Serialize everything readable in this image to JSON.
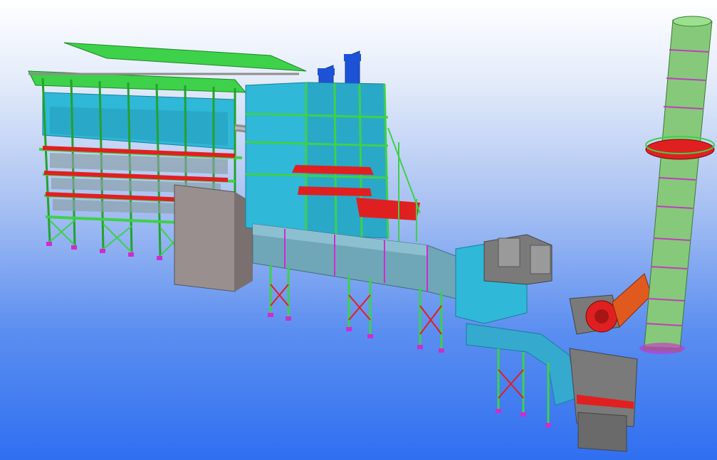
{
  "scene": {
    "kind": "3d-plant-model-view",
    "components": [
      "boiler-steel-structure",
      "heat-recovery-module",
      "flue-gas-duct",
      "scr-reactor",
      "induced-draft-fan",
      "chimney-stack"
    ]
  },
  "colors": {
    "background_top": "#ffffff",
    "background_bottom": "#2f6ff0",
    "steel": "#3ed14a",
    "steel_dark": "#22a32c",
    "panel": "#2fb8d8",
    "panel_dark": "#1d8fb0",
    "platform": "#e02020",
    "duct": "#6fa6b8",
    "duct_dark": "#4f8394",
    "pipe": "#8e8e8e",
    "support_base": "#d02bd0",
    "stack": "#86c97a",
    "stack_ring": "#c23cc2",
    "blue_hood": "#1d52d6",
    "grey_box": "#7a7a7a"
  }
}
